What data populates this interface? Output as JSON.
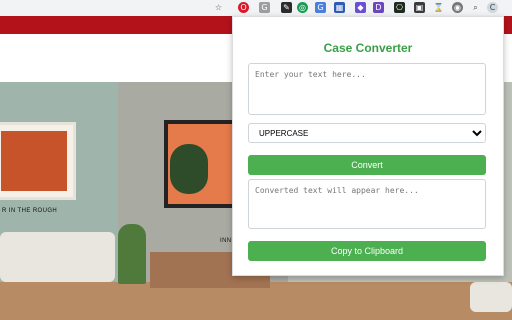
{
  "popup": {
    "title": "Case Converter",
    "input": {
      "placeholder": "Enter your text here...",
      "value": ""
    },
    "case_select": {
      "selected": "UPPERCASE",
      "options": [
        "UPPERCASE"
      ]
    },
    "convert_label": "Convert",
    "output": {
      "placeholder": "Converted text will appear here...",
      "value": ""
    },
    "copy_label": "Copy to Clipboard"
  },
  "page": {
    "caption_left": "R IN THE ROUGH",
    "caption_mid": "INN"
  },
  "toolbar": {
    "icons": [
      "star-icon",
      "opera-icon",
      "extension-icon",
      "notion-icon",
      "whatsapp-icon",
      "translate-icon",
      "calendar-icon",
      "badge-icon",
      "dropbox-icon",
      "terminal-icon",
      "extension-icon",
      "hourglass-icon",
      "chrome-icon",
      "search-icon",
      "case-converter-icon"
    ]
  },
  "colors": {
    "accent": "#4caf50",
    "title": "#3aa047",
    "brand_bar": "#b3121b"
  }
}
